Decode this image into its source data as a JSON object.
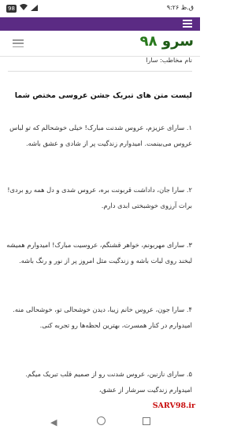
{
  "status_bar": {
    "time": "۹:۲۶ ق.ظ",
    "battery": "98"
  },
  "site": {
    "logo_text": "سرو",
    "logo_number": "۹۸"
  },
  "article": {
    "addressee": "نام مخاطب: سارا",
    "heading": "لیست متن های تبریک جشن عروسی مختص شما",
    "paragraphs": [
      "۱. سارای عزیزم، عروس شدنت مبارک! خیلی خوشحالم که تو لباس عروس می‌بینمت. امیدوارم زندگیت پر از شادی و عشق باشه.",
      "۲. سارا جان، داداشت قربونت بره، عروس شدی و دل همه رو بردی! برات آرزوی خوشبختی ابدی دارم.",
      "۳. سارای مهربونم، خواهر قشنگم، عروسیت مبارک! امیدوارم همیشه لبخند روی لبات باشه و زندگیت مثل امروز پر از نور و رنگ باشه.",
      "۴. سارا جون، عروس خانم زیبا، دیدن خوشحالی تو، خوشحالی منه. امیدوارم در کنار همسرت، بهترین لحظه‌ها رو تجربه کنی.",
      "۵. سارای نازنین، عروس شدنت رو از صمیم قلب تبریک میگم. امیدوارم زندگیت سرشار از عشق،"
    ]
  },
  "watermark": "SARV98.ir"
}
